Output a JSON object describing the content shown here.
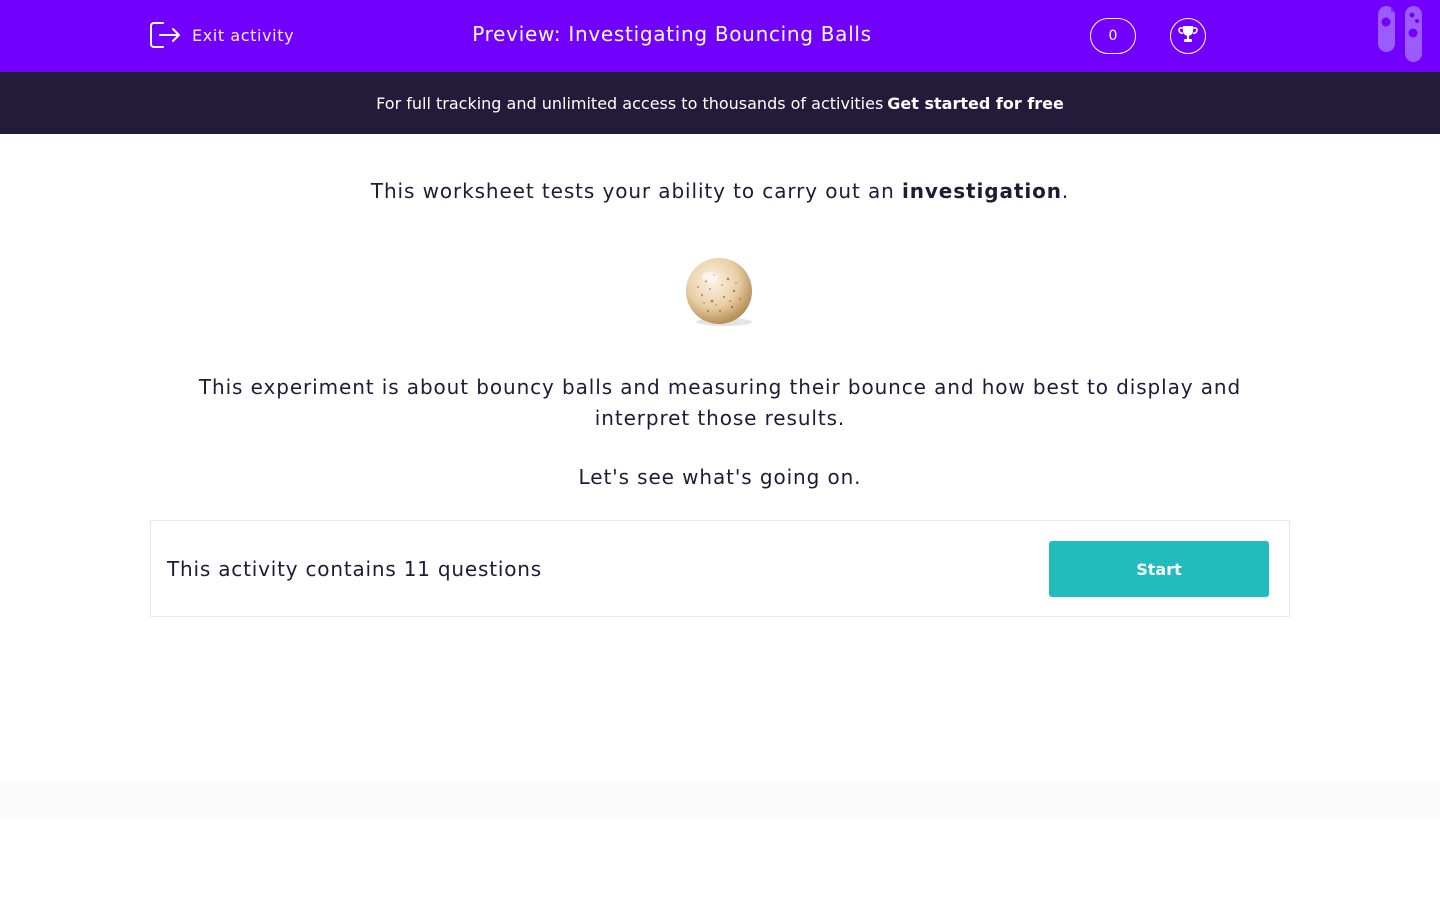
{
  "header": {
    "exit_label": "Exit activity",
    "title": "Preview: Investigating Bouncing Balls",
    "score": "0",
    "icons": [
      "exit-icon",
      "trophy-icon",
      "test-tubes-icon"
    ]
  },
  "promo": {
    "text": "For full tracking and unlimited access to thousands of activities",
    "cta": "Get started for free"
  },
  "intro": {
    "prefix": "This worksheet tests your ability to carry out an ",
    "bold": "investigation",
    "suffix": "."
  },
  "image": {
    "icon": "bouncy-ball-image"
  },
  "description": "This experiment is about bouncy balls and measuring their bounce and how best to display and interpret those results.",
  "lets_see": "Let's see what's going on.",
  "activity": {
    "summary": "This activity contains 11 questions",
    "start_label": "Start"
  },
  "colors": {
    "header_bg": "#7200ff",
    "promo_bg": "#221b3a",
    "accent_button": "#23bcbc",
    "text": "#1f1a38"
  }
}
